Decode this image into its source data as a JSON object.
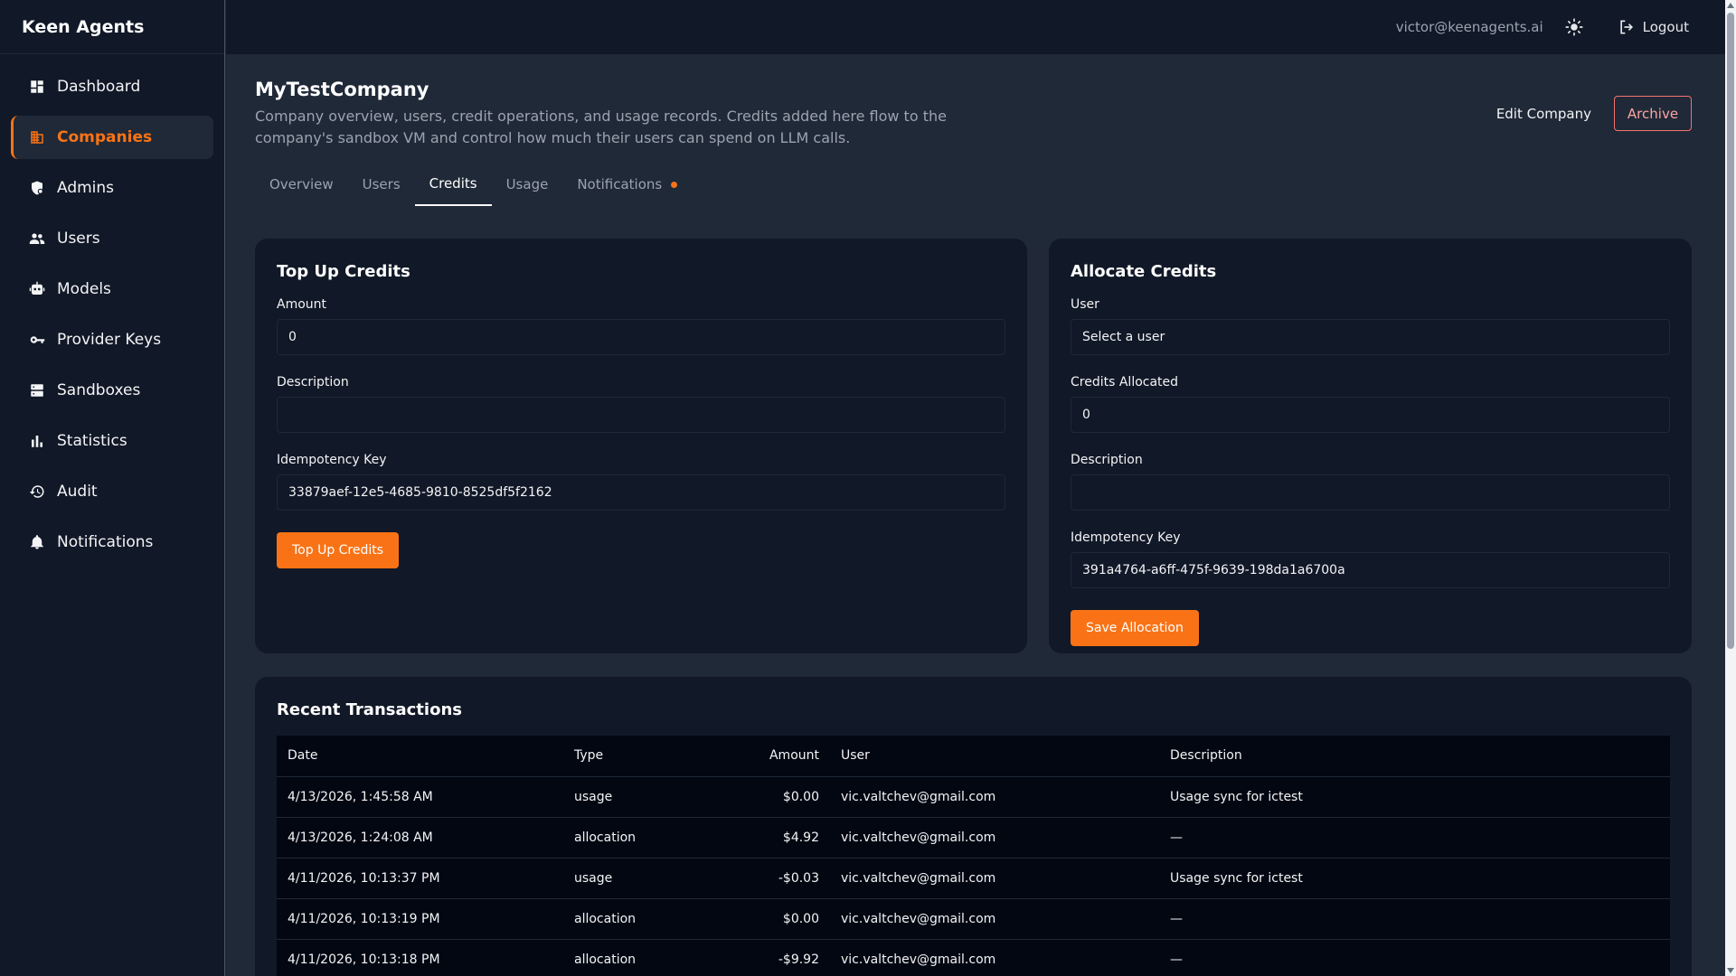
{
  "brand": "Keen Agents",
  "sidebar": {
    "items": [
      {
        "label": "Dashboard",
        "icon": "dashboard-icon"
      },
      {
        "label": "Companies",
        "icon": "building-icon",
        "active": true
      },
      {
        "label": "Admins",
        "icon": "admin-shield-icon"
      },
      {
        "label": "Users",
        "icon": "users-icon"
      },
      {
        "label": "Models",
        "icon": "robot-icon"
      },
      {
        "label": "Provider Keys",
        "icon": "key-icon"
      },
      {
        "label": "Sandboxes",
        "icon": "server-icon"
      },
      {
        "label": "Statistics",
        "icon": "bar-chart-icon"
      },
      {
        "label": "Audit",
        "icon": "history-icon"
      },
      {
        "label": "Notifications",
        "icon": "bell-icon"
      }
    ]
  },
  "header": {
    "user_email": "victor@keenagents.ai",
    "logout_label": "Logout"
  },
  "page": {
    "title": "MyTestCompany",
    "description": "Company overview, users, credit operations, and usage records. Credits added here flow to the company's sandbox VM and control how much their users can spend on LLM calls.",
    "edit_label": "Edit Company",
    "archive_label": "Archive"
  },
  "tabs": [
    {
      "label": "Overview"
    },
    {
      "label": "Users"
    },
    {
      "label": "Credits",
      "active": true
    },
    {
      "label": "Usage"
    },
    {
      "label": "Notifications",
      "dot": true
    }
  ],
  "topup": {
    "title": "Top Up Credits",
    "amount_label": "Amount",
    "amount_value": "0",
    "description_label": "Description",
    "description_value": "",
    "idempotency_label": "Idempotency Key",
    "idempotency_value": "33879aef-12e5-4685-9810-8525df5f2162",
    "button_label": "Top Up Credits"
  },
  "allocate": {
    "title": "Allocate Credits",
    "user_label": "User",
    "user_value": "Select a user",
    "credits_label": "Credits Allocated",
    "credits_value": "0",
    "description_label": "Description",
    "description_value": "",
    "idempotency_label": "Idempotency Key",
    "idempotency_value": "391a4764-a6ff-475f-9639-198da1a6700a",
    "button_label": "Save Allocation"
  },
  "transactions": {
    "title": "Recent Transactions",
    "columns": [
      "Date",
      "Type",
      "Amount",
      "User",
      "Description"
    ],
    "rows": [
      {
        "date": "4/13/2026, 1:45:58 AM",
        "type": "usage",
        "amount": "$0.00",
        "user": "vic.valtchev@gmail.com",
        "description": "Usage sync for ictest"
      },
      {
        "date": "4/13/2026, 1:24:08 AM",
        "type": "allocation",
        "amount": "$4.92",
        "user": "vic.valtchev@gmail.com",
        "description": "—"
      },
      {
        "date": "4/11/2026, 10:13:37 PM",
        "type": "usage",
        "amount": "-$0.03",
        "user": "vic.valtchev@gmail.com",
        "description": "Usage sync for ictest"
      },
      {
        "date": "4/11/2026, 10:13:19 PM",
        "type": "allocation",
        "amount": "$0.00",
        "user": "vic.valtchev@gmail.com",
        "description": "—"
      },
      {
        "date": "4/11/2026, 10:13:18 PM",
        "type": "allocation",
        "amount": "-$9.92",
        "user": "vic.valtchev@gmail.com",
        "description": "—"
      }
    ]
  },
  "colors": {
    "accent": "#f97316",
    "danger": "#f87171",
    "sidebar_bg": "#111827",
    "main_bg": "#1f2937"
  }
}
